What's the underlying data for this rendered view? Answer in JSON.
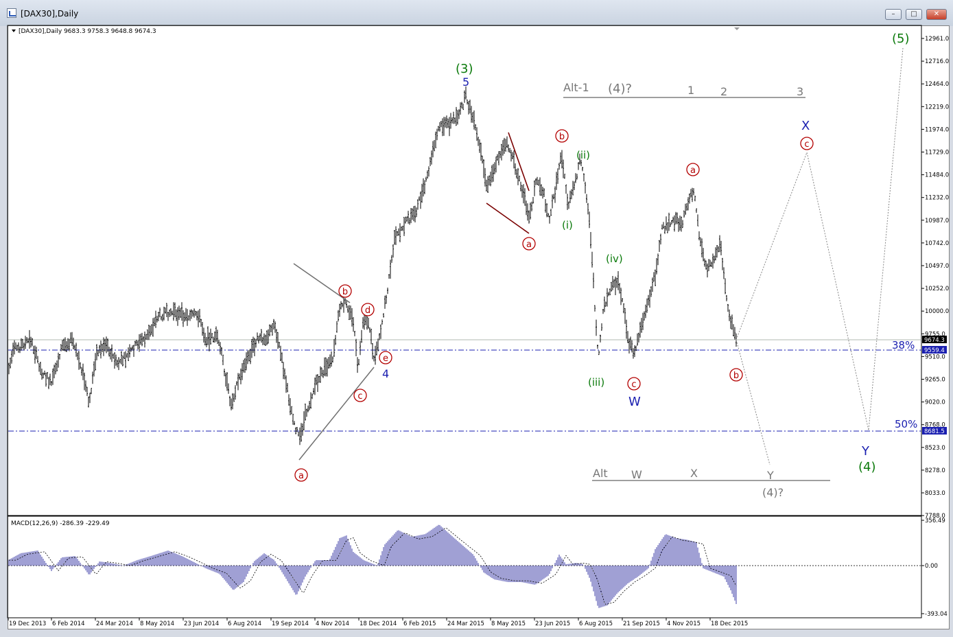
{
  "window": {
    "title": "[DAX30],Daily",
    "buttons": {
      "minimize": "–",
      "maximize": "□",
      "close": "✕"
    }
  },
  "chart_header": "[DAX30],Daily  9683.3 9758.3 9648.8 9674.3",
  "macd_header": "MACD(12,26,9) -286.39 -229.49",
  "price_axis": [
    "12961.0",
    "12716.0",
    "12464.0",
    "12219.0",
    "11974.0",
    "11729.0",
    "11484.0",
    "11232.0",
    "10987.0",
    "10742.0",
    "10497.0",
    "10252.0",
    "10000.0",
    "9755.0",
    "9510.0",
    "9265.0",
    "9020.0",
    "8768.0",
    "8523.0",
    "8278.0",
    "8033.0",
    "7788.0"
  ],
  "price_tags": {
    "current": "9674.3",
    "fib38": "9559.4",
    "fib50": "8681.5"
  },
  "macd_axis": {
    "top": "356.49",
    "zero": "0.00",
    "bottom": "-393.04"
  },
  "time_axis": [
    "19 Dec 2013",
    "6 Feb 2014",
    "24 Mar 2014",
    "8 May 2014",
    "23 Jun 2014",
    "6 Aug 2014",
    "19 Sep 2014",
    "4 Nov 2014",
    "18 Dec 2014",
    "6 Feb 2015",
    "24 Mar 2015",
    "8 May 2015",
    "23 Jun 2015",
    "6 Aug 2015",
    "21 Sep 2015",
    "4 Nov 2015",
    "18 Dec 2015"
  ],
  "fib_labels": {
    "fib38": "38%",
    "fib50": "50%"
  },
  "wave_labels": {
    "w3": "(3)",
    "w5_top": "5",
    "w4_small": "4",
    "w5_big": "(5)",
    "w4_big": "(4)",
    "sub_i": "(i)",
    "sub_ii": "(ii)",
    "sub_iii": "(iii)",
    "sub_iv": "(iv)",
    "W": "W",
    "X": "X",
    "Y": "Y"
  },
  "circled": {
    "a1": "a",
    "b1": "b",
    "c1": "c",
    "d1": "d",
    "e1": "e",
    "a2": "a",
    "b2": "b",
    "c2": "c",
    "a3": "a",
    "b3": "b",
    "c3": "c"
  },
  "alt1": {
    "label": "Alt-1",
    "w4": "(4)?",
    "n1": "1",
    "n2": "2",
    "n3": "3"
  },
  "alt": {
    "label": "Alt",
    "W": "W",
    "X": "X",
    "Y": "Y",
    "w4": "(4)?"
  },
  "colors": {
    "green": "#0b7a0b",
    "blue": "#1a1fb0",
    "red": "#b30000",
    "gray": "#7a7a7a",
    "bars": "#000000",
    "macd": "#4040a8"
  }
}
